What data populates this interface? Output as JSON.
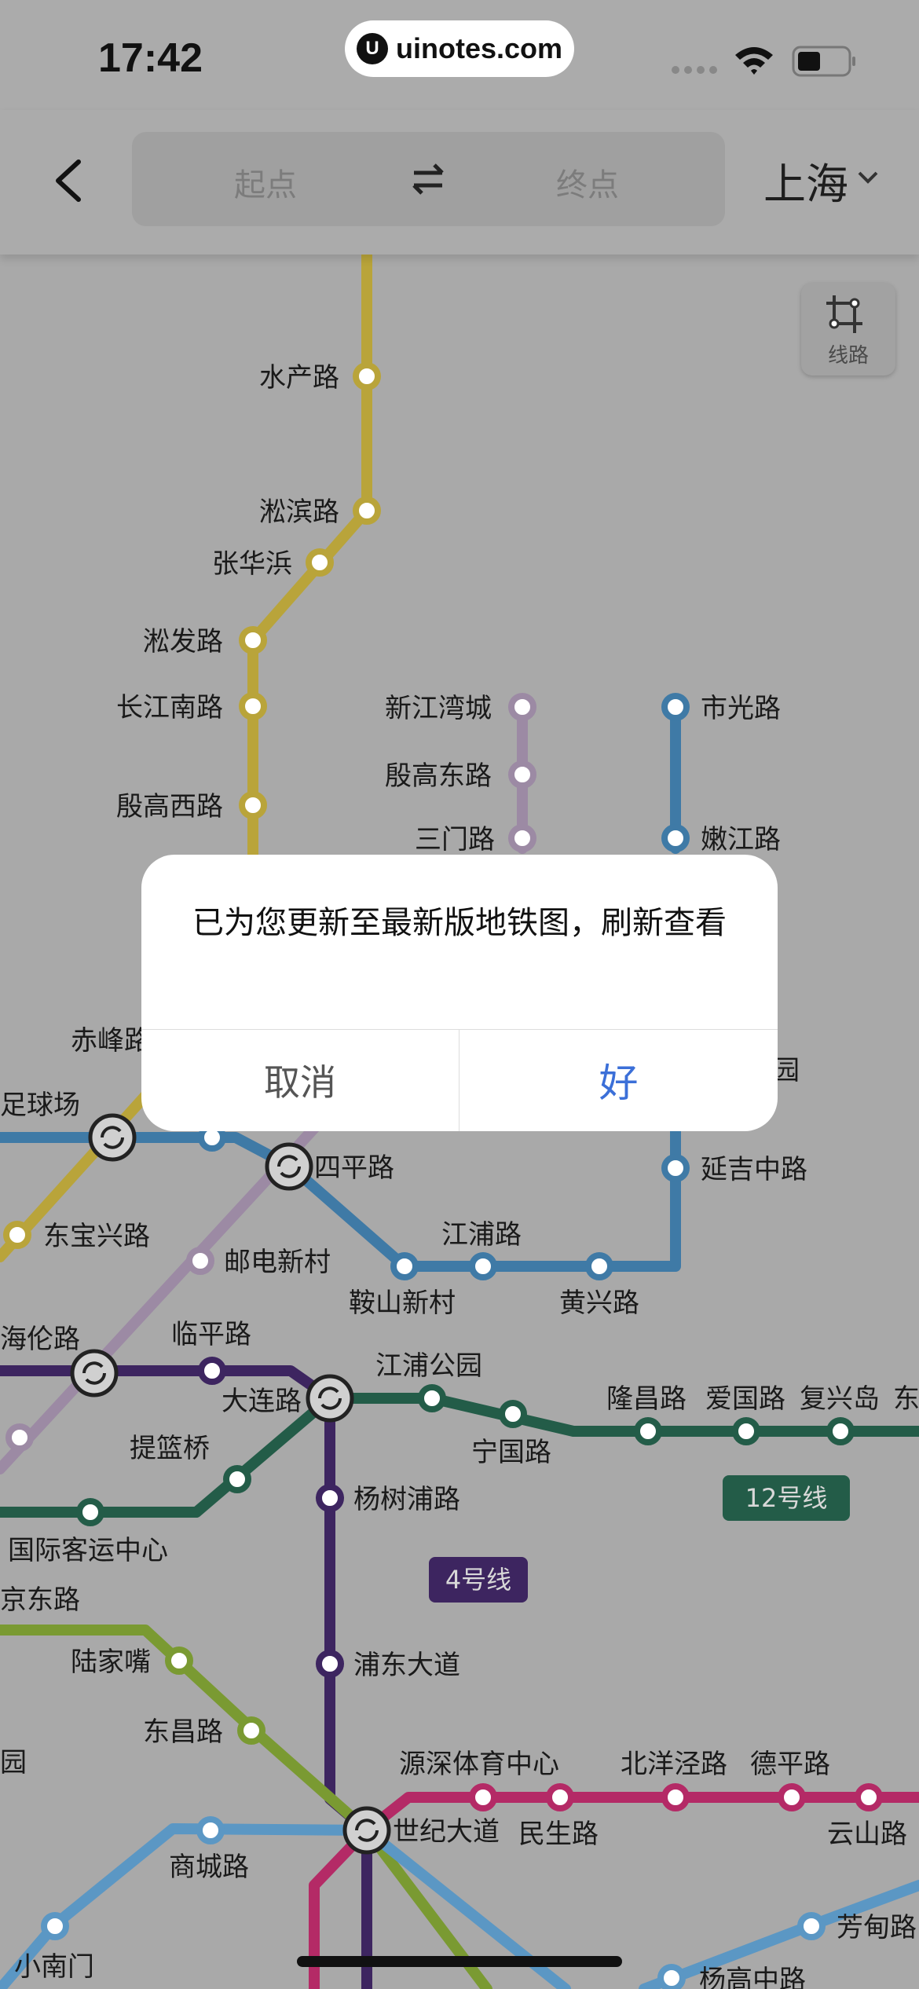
{
  "status_bar": {
    "time": "17:42",
    "url": "uinotes.com"
  },
  "header": {
    "start_placeholder": "起点",
    "end_placeholder": "终点",
    "city": "上海"
  },
  "line_button": {
    "label": "线路"
  },
  "map": {
    "stations": {
      "s1": "水产路",
      "s2": "淞滨路",
      "s3": "张华浜",
      "s4": "淞发路",
      "s5": "长江南路",
      "s6": "殷高西路",
      "s7": "新江湾城",
      "s8": "殷高东路",
      "s9": "三门路",
      "s10": "市光路",
      "s11": "嫩江路",
      "s12": "赤峰路",
      "s13": "四平路",
      "s14": "延吉中路",
      "s15": "东宝兴路",
      "s16": "邮电新村",
      "s17": "江浦路",
      "s18": "鞍山新村",
      "s19": "黄兴路",
      "s20": "临平路",
      "s21": "江浦公园",
      "s22": "大连路",
      "s23": "隆昌路",
      "s24": "爱国路",
      "s25": "复兴岛",
      "s26": "宁国路",
      "s27": "提篮桥",
      "s28": "杨树浦路",
      "s29": "国际客运中心",
      "s30": "陆家嘴",
      "s31": "浦东大道",
      "s32": "东昌路",
      "s33": "源深体育中心",
      "s34": "北洋泾路",
      "s35": "德平路",
      "s36": "世纪大道",
      "s37": "民生路",
      "s38": "商城路",
      "s39": "云山路",
      "s40": "小南门",
      "s41": "芳甸路",
      "s42": "杨高中路"
    },
    "partial_labels": {
      "p1": "足球场",
      "p2": "海伦路",
      "p3": "京东路",
      "p4": "公园",
      "p5": "东",
      "p6": "园"
    },
    "line_badges": {
      "line12": "12号线",
      "line4": "4号线"
    }
  },
  "dialog": {
    "message": "已为您更新至最新版地铁图，刷新查看",
    "cancel": "取消",
    "ok": "好"
  },
  "colors": {
    "line3_yellow": "#b9a43a",
    "line10_purple": "#9c8aa4",
    "line8_blue": "#3f7aa6",
    "line4_purple": "#3d2560",
    "line12_green": "#235c48",
    "line2_green": "#7a9a32",
    "line6_magenta": "#b42a66",
    "line9_blue": "#5b97c4",
    "ok_blue": "#3b6fd8"
  }
}
